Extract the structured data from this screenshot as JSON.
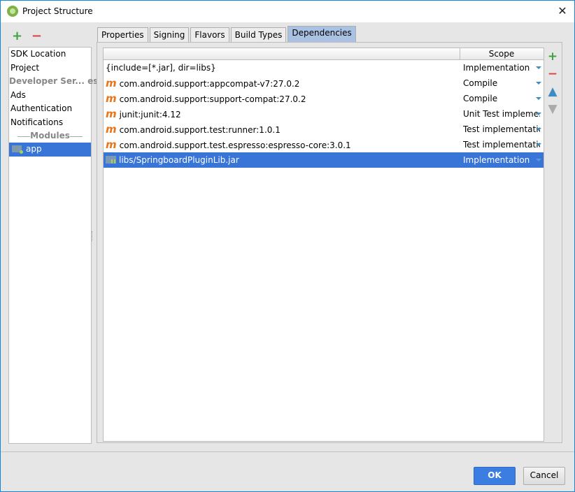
{
  "window": {
    "title": "Project Structure",
    "close_icon": "close-icon"
  },
  "left_toolbar": {
    "add_icon": "+",
    "remove_icon": "−"
  },
  "left_list": {
    "items": [
      "SDK Location",
      "Project"
    ],
    "developer_services_header": "Developer Ser... es",
    "services": [
      "Ads",
      "Authentication",
      "Notifications"
    ],
    "modules_header": "Modules",
    "modules": [
      {
        "label": "app",
        "selected": true
      }
    ]
  },
  "tabs": [
    "Properties",
    "Signing",
    "Flavors",
    "Build Types",
    "Dependencies"
  ],
  "active_tab": "Dependencies",
  "table": {
    "columns": [
      "",
      "Scope"
    ],
    "rows": [
      {
        "icon": "none",
        "name": "{include=[*.jar], dir=libs}",
        "scope": "Implementation"
      },
      {
        "icon": "maven",
        "name": "com.android.support:appcompat-v7:27.0.2",
        "scope": "Compile"
      },
      {
        "icon": "maven",
        "name": "com.android.support:support-compat:27.0.2",
        "scope": "Compile"
      },
      {
        "icon": "maven",
        "name": "junit:junit:4.12",
        "scope": "Unit Test impleme..."
      },
      {
        "icon": "maven",
        "name": "com.android.support.test:runner:1.0.1",
        "scope": "Test implementation"
      },
      {
        "icon": "maven",
        "name": "com.android.support.test.espresso:espresso-core:3.0.1",
        "scope": "Test implementation"
      },
      {
        "icon": "jar",
        "name": "libs/SpringboardPluginLib.jar",
        "scope": "Implementation",
        "selected": true
      }
    ]
  },
  "side_toolbar": {
    "add": "+",
    "remove": "−",
    "move_up": "🡅",
    "move_down": "🡇"
  },
  "buttons": {
    "ok": "OK",
    "cancel": "Cancel"
  },
  "maven_glyph": "m"
}
